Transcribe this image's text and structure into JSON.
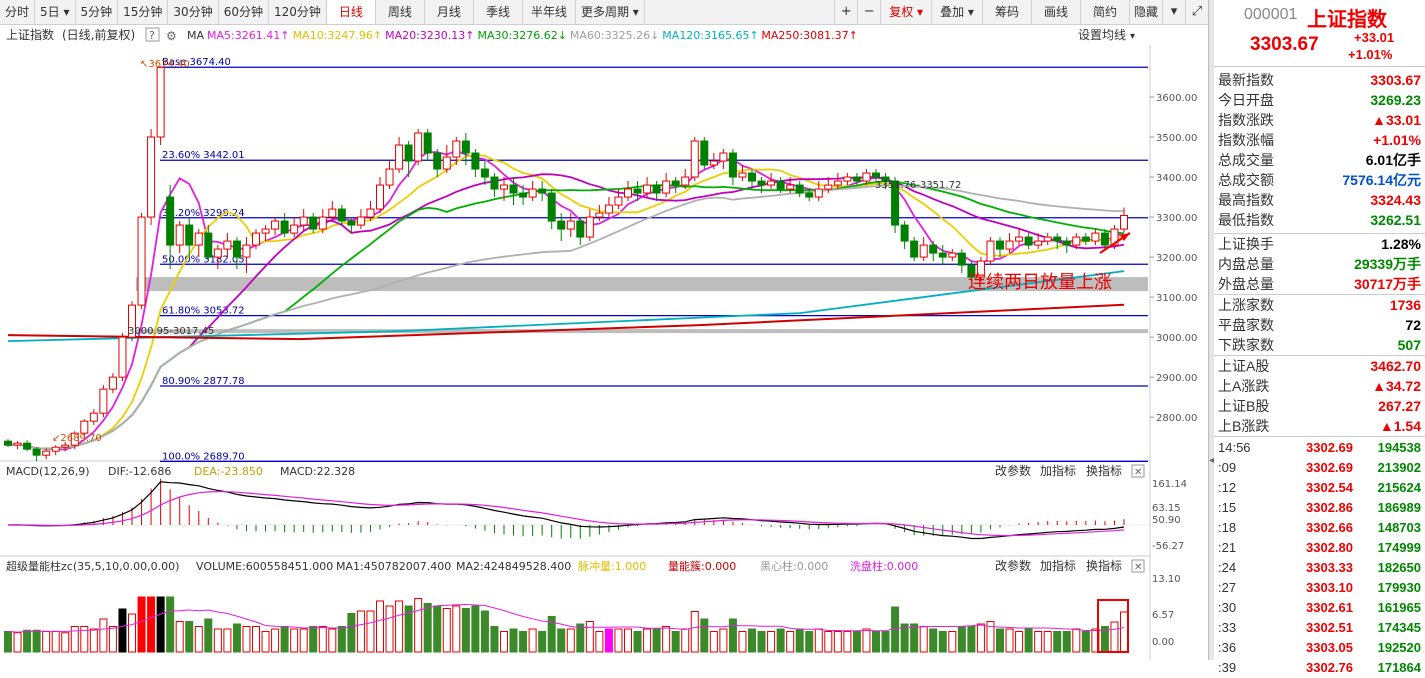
{
  "toolbar": {
    "periods": [
      "分时",
      "5日",
      "5分钟",
      "15分钟",
      "30分钟",
      "60分钟",
      "120分钟",
      "日线",
      "周线",
      "月线",
      "季线",
      "半年线",
      "更多周期"
    ],
    "active_period": "日线",
    "right_tools": [
      "复权",
      "叠加",
      "筹码",
      "画线",
      "简约",
      "隐藏"
    ]
  },
  "header": {
    "title": "上证指数",
    "subtitle": "(日线,前复权)",
    "ma_prefix": "MA",
    "ma_items": [
      {
        "label": "MA5:3261.41",
        "color": "#e020e0",
        "arrow": "↑"
      },
      {
        "label": "MA10:3247.96",
        "color": "#e0c000",
        "arrow": "↑"
      },
      {
        "label": "MA20:3230.13",
        "color": "#c000c0",
        "arrow": "↑"
      },
      {
        "label": "MA30:3276.62",
        "color": "#00a000",
        "arrow": "↓"
      },
      {
        "label": "MA60:3325.26",
        "color": "#a0a0a0",
        "arrow": "↓"
      },
      {
        "label": "MA120:3165.65",
        "color": "#00b0c0",
        "arrow": "↑"
      },
      {
        "label": "MA250:3081.37",
        "color": "#e00000",
        "arrow": "↑"
      }
    ],
    "settings": "设置均线"
  },
  "main": {
    "ylim": [
      2700,
      3700
    ],
    "y_ticks": [
      "3600.00",
      "3500.00",
      "3400.00",
      "3300.00",
      "3200.00",
      "3100.00",
      "3000.00",
      "2900.00",
      "2800.00"
    ],
    "fib_levels": [
      {
        "value": 3674.4,
        "label": "Base   3674.40"
      },
      {
        "value": 3442.01,
        "label": "23.60% 3442.01"
      },
      {
        "value": 3298.24,
        "label": "38.20% 3298.24"
      },
      {
        "value": 3182.05,
        "label": "50.00% 3182.05"
      },
      {
        "value": 3053.72,
        "label": "61.80% 3053.72"
      },
      {
        "value": 2877.78,
        "label": "80.90% 2877.78"
      },
      {
        "value": 2689.7,
        "label": "100.0% 2689.70"
      }
    ],
    "high_mark": "3674.40",
    "low_mark": "2689.70",
    "range_marks": [
      "3351.76-3351.72",
      "3000.95-3017.45"
    ],
    "annotation": "连续两日放量上涨"
  },
  "macd": {
    "title": "MACD(12,26,9)",
    "dif": "DIF:-12.686",
    "dea": "DEA:-23.850",
    "macd": "MACD:22.328",
    "buttons": [
      "改参数",
      "加指标",
      "换指标"
    ],
    "y_ticks": [
      "161.14",
      "63.15",
      "50.90",
      "-56.27"
    ]
  },
  "volume": {
    "title": "超级量能柱zc(35,5,10,0.00,0.00)",
    "vol": "VOLUME:600558451.000",
    "ma1": "MA1:450782007.400",
    "ma2": "MA2:424849528.400",
    "pulse": "脉冲量:1.000",
    "energy": "量能簇:0.000",
    "black": "黑心柱:0.000",
    "wash": "洗盘柱:0.000",
    "buttons": [
      "改参数",
      "加指标",
      "换指标"
    ],
    "y_ticks": [
      "13.10",
      "6.57",
      "0.00"
    ]
  },
  "panel": {
    "code": "000001",
    "name": "上证指数",
    "price": "3303.67",
    "change": "+33.01",
    "change_pct": "+1.01%",
    "stats": [
      {
        "k": "最新指数",
        "v": "3303.67",
        "c": "red"
      },
      {
        "k": "今日开盘",
        "v": "3269.23",
        "c": "grn"
      },
      {
        "k": "指数涨跌",
        "v": "▲33.01",
        "c": "red"
      },
      {
        "k": "指数涨幅",
        "v": "+1.01%",
        "c": "red"
      },
      {
        "k": "总成交量",
        "v": "6.01亿手",
        "c": "blk"
      },
      {
        "k": "总成交额",
        "v": "7576.14亿元",
        "c": "blu"
      },
      {
        "k": "最高指数",
        "v": "3324.43",
        "c": "red"
      },
      {
        "k": "最低指数",
        "v": "3262.51",
        "c": "grn"
      }
    ],
    "stats2": [
      {
        "k": "上证换手",
        "v": "1.28%",
        "c": "blk"
      },
      {
        "k": "内盘总量",
        "v": "29339万手",
        "c": "grn"
      },
      {
        "k": "外盘总量",
        "v": "30717万手",
        "c": "red"
      }
    ],
    "stats3": [
      {
        "k": "上涨家数",
        "v": "1736",
        "c": "red"
      },
      {
        "k": "平盘家数",
        "v": "72",
        "c": "blk"
      },
      {
        "k": "下跌家数",
        "v": "507",
        "c": "grn"
      }
    ],
    "stats4": [
      {
        "k": "上证A股",
        "v": "3462.70",
        "c": "red"
      },
      {
        "k": "上A涨跌",
        "v": "▲34.72",
        "c": "red"
      },
      {
        "k": "上证B股",
        "v": "267.27",
        "c": "red"
      },
      {
        "k": "上B涨跌",
        "v": "▲1.54",
        "c": "red"
      }
    ],
    "ticks": [
      {
        "t": "14:56",
        "p": "3302.69",
        "q": "194538"
      },
      {
        "t": ":09",
        "p": "3302.69",
        "q": "213902"
      },
      {
        "t": ":12",
        "p": "3302.54",
        "q": "215624"
      },
      {
        "t": ":15",
        "p": "3302.86",
        "q": "186989"
      },
      {
        "t": ":18",
        "p": "3302.66",
        "q": "148703"
      },
      {
        "t": ":21",
        "p": "3302.80",
        "q": "174999"
      },
      {
        "t": ":24",
        "p": "3303.33",
        "q": "182650"
      },
      {
        "t": ":27",
        "p": "3303.10",
        "q": "179930"
      },
      {
        "t": ":30",
        "p": "3302.61",
        "q": "161965"
      },
      {
        "t": ":33",
        "p": "3302.51",
        "q": "174345"
      },
      {
        "t": ":36",
        "p": "3303.05",
        "q": "192520"
      },
      {
        "t": ":39",
        "p": "3302.76",
        "q": "171864"
      }
    ]
  },
  "chart_data": {
    "type": "candlestick",
    "ylim": [
      2700,
      3700
    ],
    "candles": [
      [
        2740,
        2730,
        2745,
        2725
      ],
      [
        2730,
        2735,
        2740,
        2720
      ],
      [
        2735,
        2720,
        2742,
        2715
      ],
      [
        2720,
        2705,
        2725,
        2690
      ],
      [
        2705,
        2715,
        2722,
        2695
      ],
      [
        2715,
        2725,
        2730,
        2705
      ],
      [
        2725,
        2730,
        2738,
        2715
      ],
      [
        2730,
        2760,
        2765,
        2720
      ],
      [
        2760,
        2790,
        2795,
        2750
      ],
      [
        2790,
        2810,
        2820,
        2780
      ],
      [
        2810,
        2870,
        2880,
        2800
      ],
      [
        2870,
        2900,
        2910,
        2860
      ],
      [
        2900,
        3000,
        3010,
        2890
      ],
      [
        3000,
        3080,
        3090,
        2990
      ],
      [
        3080,
        3300,
        3310,
        3070
      ],
      [
        3300,
        3500,
        3520,
        3280
      ],
      [
        3500,
        3674,
        3674,
        3480
      ],
      [
        3350,
        3230,
        3380,
        3170
      ],
      [
        3230,
        3280,
        3290,
        3210
      ],
      [
        3280,
        3230,
        3300,
        3200
      ],
      [
        3230,
        3260,
        3270,
        3200
      ],
      [
        3260,
        3200,
        3280,
        3190
      ],
      [
        3200,
        3220,
        3230,
        3170
      ],
      [
        3220,
        3240,
        3260,
        3200
      ],
      [
        3240,
        3200,
        3250,
        3170
      ],
      [
        3200,
        3230,
        3250,
        3160
      ],
      [
        3230,
        3260,
        3270,
        3220
      ],
      [
        3260,
        3270,
        3280,
        3240
      ],
      [
        3270,
        3290,
        3300,
        3255
      ],
      [
        3290,
        3260,
        3310,
        3250
      ],
      [
        3260,
        3280,
        3300,
        3250
      ],
      [
        3280,
        3300,
        3320,
        3265
      ],
      [
        3300,
        3270,
        3310,
        3260
      ],
      [
        3270,
        3300,
        3320,
        3260
      ],
      [
        3300,
        3320,
        3340,
        3290
      ],
      [
        3320,
        3290,
        3330,
        3280
      ],
      [
        3290,
        3280,
        3300,
        3260
      ],
      [
        3280,
        3300,
        3320,
        3270
      ],
      [
        3300,
        3320,
        3340,
        3290
      ],
      [
        3320,
        3380,
        3400,
        3310
      ],
      [
        3380,
        3420,
        3440,
        3370
      ],
      [
        3420,
        3480,
        3500,
        3410
      ],
      [
        3480,
        3440,
        3490,
        3400
      ],
      [
        3440,
        3510,
        3520,
        3430
      ],
      [
        3510,
        3460,
        3520,
        3440
      ],
      [
        3460,
        3420,
        3470,
        3400
      ],
      [
        3420,
        3450,
        3480,
        3410
      ],
      [
        3450,
        3490,
        3500,
        3430
      ],
      [
        3490,
        3460,
        3510,
        3430
      ],
      [
        3460,
        3420,
        3470,
        3400
      ],
      [
        3420,
        3400,
        3440,
        3380
      ],
      [
        3400,
        3370,
        3410,
        3350
      ],
      [
        3370,
        3380,
        3400,
        3340
      ],
      [
        3380,
        3360,
        3400,
        3330
      ],
      [
        3360,
        3350,
        3380,
        3330
      ],
      [
        3350,
        3370,
        3390,
        3340
      ],
      [
        3370,
        3360,
        3390,
        3340
      ],
      [
        3360,
        3290,
        3370,
        3270
      ],
      [
        3290,
        3270,
        3310,
        3240
      ],
      [
        3270,
        3290,
        3310,
        3250
      ],
      [
        3290,
        3250,
        3300,
        3230
      ],
      [
        3250,
        3300,
        3320,
        3240
      ],
      [
        3300,
        3310,
        3330,
        3290
      ],
      [
        3310,
        3330,
        3350,
        3300
      ],
      [
        3330,
        3350,
        3370,
        3320
      ],
      [
        3350,
        3370,
        3390,
        3340
      ],
      [
        3370,
        3360,
        3390,
        3340
      ],
      [
        3360,
        3380,
        3400,
        3350
      ],
      [
        3380,
        3360,
        3390,
        3340
      ],
      [
        3360,
        3390,
        3410,
        3350
      ],
      [
        3390,
        3380,
        3400,
        3360
      ],
      [
        3380,
        3400,
        3420,
        3370
      ],
      [
        3400,
        3490,
        3500,
        3390
      ],
      [
        3490,
        3430,
        3500,
        3420
      ],
      [
        3430,
        3440,
        3460,
        3420
      ],
      [
        3440,
        3460,
        3470,
        3420
      ],
      [
        3460,
        3400,
        3470,
        3380
      ],
      [
        3400,
        3410,
        3430,
        3390
      ],
      [
        3410,
        3390,
        3420,
        3370
      ],
      [
        3390,
        3380,
        3400,
        3360
      ],
      [
        3380,
        3390,
        3410,
        3370
      ],
      [
        3390,
        3370,
        3400,
        3360
      ],
      [
        3370,
        3380,
        3400,
        3360
      ],
      [
        3380,
        3360,
        3390,
        3350
      ],
      [
        3360,
        3350,
        3370,
        3340
      ],
      [
        3350,
        3370,
        3390,
        3340
      ],
      [
        3370,
        3380,
        3400,
        3360
      ],
      [
        3380,
        3390,
        3410,
        3370
      ],
      [
        3390,
        3400,
        3410,
        3380
      ],
      [
        3400,
        3390,
        3410,
        3380
      ],
      [
        3390,
        3410,
        3420,
        3380
      ],
      [
        3410,
        3400,
        3420,
        3390
      ],
      [
        3400,
        3390,
        3410,
        3370
      ],
      [
        3390,
        3280,
        3400,
        3260
      ],
      [
        3280,
        3240,
        3290,
        3220
      ],
      [
        3240,
        3200,
        3250,
        3190
      ],
      [
        3200,
        3230,
        3250,
        3190
      ],
      [
        3230,
        3210,
        3240,
        3190
      ],
      [
        3210,
        3200,
        3230,
        3180
      ],
      [
        3200,
        3210,
        3220,
        3190
      ],
      [
        3210,
        3180,
        3220,
        3160
      ],
      [
        3180,
        3150,
        3190,
        3140
      ],
      [
        3150,
        3190,
        3200,
        3140
      ],
      [
        3190,
        3240,
        3250,
        3180
      ],
      [
        3240,
        3220,
        3250,
        3200
      ],
      [
        3220,
        3240,
        3260,
        3210
      ],
      [
        3240,
        3250,
        3270,
        3230
      ],
      [
        3250,
        3230,
        3260,
        3220
      ],
      [
        3230,
        3240,
        3260,
        3220
      ],
      [
        3240,
        3250,
        3260,
        3230
      ],
      [
        3250,
        3240,
        3260,
        3220
      ],
      [
        3240,
        3230,
        3250,
        3210
      ],
      [
        3230,
        3250,
        3260,
        3220
      ],
      [
        3250,
        3240,
        3260,
        3230
      ],
      [
        3240,
        3260,
        3270,
        3230
      ],
      [
        3260,
        3230,
        3270,
        3220
      ],
      [
        3230,
        3270,
        3280,
        3220
      ],
      [
        3270,
        3304,
        3324,
        3262
      ]
    ]
  }
}
